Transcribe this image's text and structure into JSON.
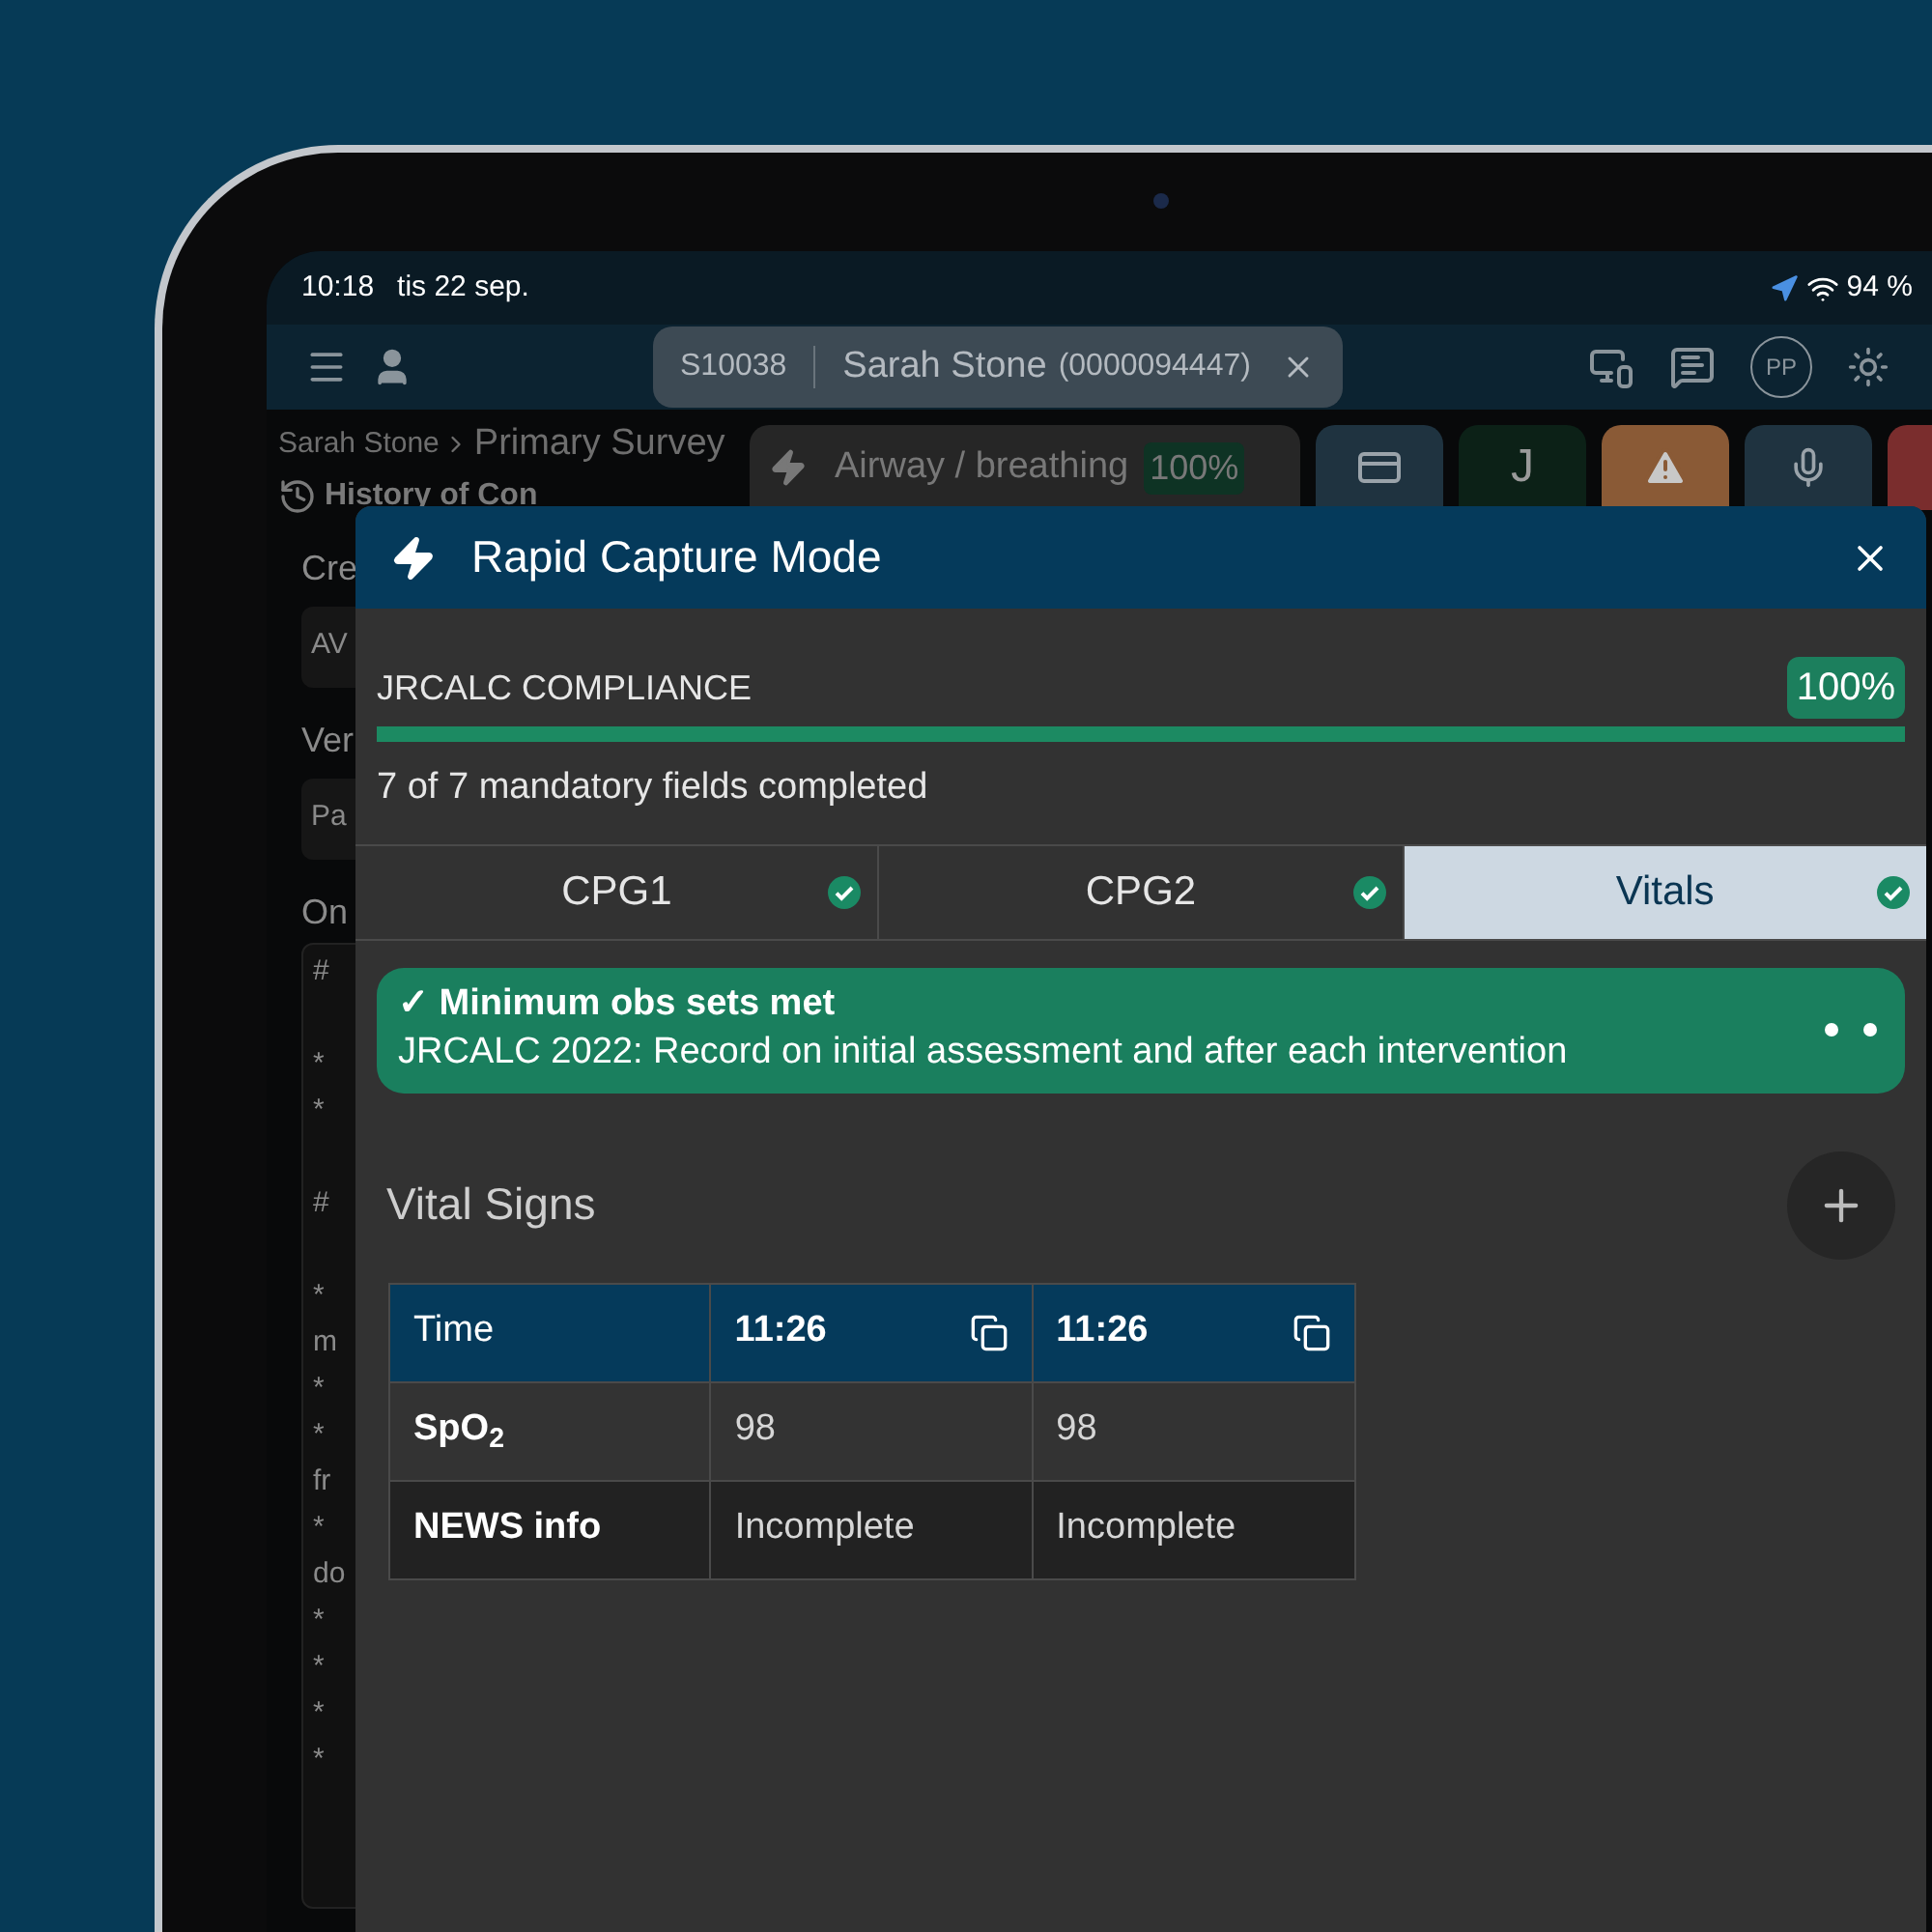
{
  "status_bar": {
    "time": "10:18",
    "date": "tis 22 sep.",
    "battery": "94 %"
  },
  "app_header": {
    "patient": {
      "id": "S10038",
      "name": "Sarah Stone",
      "number": "(0000094447)"
    },
    "avatar": "PP"
  },
  "background": {
    "breadcrumb": [
      "Sarah Stone",
      "Primary Survey"
    ],
    "heading": "History of Con",
    "fields": [
      {
        "label": "Cre",
        "value": "AV"
      },
      {
        "label": "Ver",
        "value": "Pa"
      }
    ],
    "notes_label": "On",
    "notes_blocks": [
      [
        "#"
      ],
      [
        "*",
        "*"
      ],
      [
        "#"
      ],
      [
        "*",
        "m",
        "*",
        "*",
        "fr",
        "*",
        "do",
        "*",
        "*",
        "*",
        "*"
      ]
    ],
    "section_pill": {
      "label": "Airway / breathing",
      "badge": "100%"
    },
    "tiles": [
      {
        "kind": "list",
        "color": "#1f3340"
      },
      {
        "kind": "text",
        "text": "J",
        "color": "#0c2117"
      },
      {
        "kind": "warning",
        "color": "#8a5a36"
      },
      {
        "kind": "mic",
        "color": "#1f3340"
      },
      {
        "kind": "blank",
        "color": "#7a2d2d"
      }
    ]
  },
  "modal": {
    "title": "Rapid Capture Mode",
    "compliance": {
      "label": "JRCALC COMPLIANCE",
      "badge": "100%",
      "level": 1,
      "summary": "7 of 7 mandatory fields completed"
    },
    "tabs": [
      {
        "label": "CPG1",
        "selected": false,
        "complete": true
      },
      {
        "label": "CPG2",
        "selected": false,
        "complete": true
      },
      {
        "label": "Vitals",
        "selected": true,
        "complete": true
      }
    ],
    "alert": {
      "title": "✓ Minimum obs sets met",
      "text": "JRCALC 2022: Record on initial assessment and after each intervention"
    },
    "section_title": "Vital Signs",
    "table": {
      "header": {
        "label": "Time",
        "cells": [
          "11:26",
          "11:26"
        ]
      },
      "rows": [
        {
          "label": "SpO$_{2}$",
          "cells": [
            "98",
            "98"
          ]
        },
        {
          "label": "NEWS info",
          "cells": [
            "Incomplete",
            "Incomplete"
          ]
        }
      ]
    }
  }
}
